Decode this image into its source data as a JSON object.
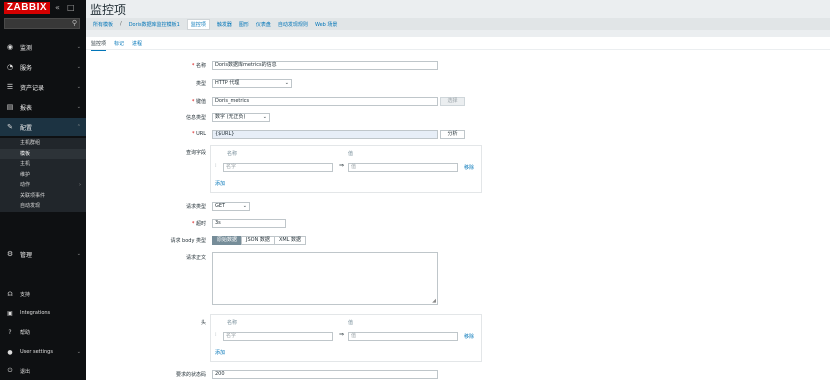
{
  "sidebar": {
    "logo": "ZABBIX",
    "collapse_icon": "«",
    "kiosk_icon": "□",
    "menu": [
      {
        "icon": "eye-icon",
        "glyph": "◉",
        "label": "监测"
      },
      {
        "icon": "clock-icon",
        "glyph": "◔",
        "label": "服务"
      },
      {
        "icon": "list-icon",
        "glyph": "☰",
        "label": "资产记录"
      },
      {
        "icon": "chart-icon",
        "glyph": "▤",
        "label": "报表"
      },
      {
        "icon": "wrench-icon",
        "glyph": "✎",
        "label": "配置"
      }
    ],
    "config_sub": [
      {
        "label": "主机群组"
      },
      {
        "label": "模板"
      },
      {
        "label": "主机"
      },
      {
        "label": "维护"
      },
      {
        "label": "动作"
      },
      {
        "label": "关联项事件"
      },
      {
        "label": "自动发现"
      }
    ],
    "admin": {
      "icon": "gear-icon",
      "glyph": "⚙",
      "label": "管理"
    },
    "footer": [
      {
        "icon": "support-icon",
        "glyph": "☊",
        "label": "支持"
      },
      {
        "icon": "integrations-icon",
        "glyph": "▣",
        "label": "Integrations"
      },
      {
        "icon": "help-icon",
        "glyph": "?",
        "label": "帮助"
      },
      {
        "icon": "user-icon",
        "glyph": "●",
        "label": "User settings"
      },
      {
        "icon": "power-icon",
        "glyph": "⏻",
        "label": "退出"
      }
    ]
  },
  "page": {
    "title": "监控项",
    "breadcrumbs": [
      "所有模板",
      "Doris数据库监控模板1",
      "监控项",
      "触发器",
      "图形",
      "仪表盘",
      "自动发现规则",
      "Web 场景"
    ],
    "breadcrumb_sep": "/",
    "tabs": [
      "监控项",
      "标记",
      "进程"
    ]
  },
  "form": {
    "name_label": "名称",
    "name_value": "Doris数据库metrics的信息",
    "type_label": "类型",
    "type_value": "HTTP 代理",
    "key_label": "键值",
    "key_value": "Doris_metrics",
    "select_btn": "选择",
    "info_type_label": "信息类型",
    "info_type_value": "数字 (无正负)",
    "url_label": "URL",
    "url_value": "{$URL}",
    "parse_btn": "分析",
    "query_label": "查询字段",
    "col_name": "名称",
    "col_value": "值",
    "name_placeholder": "名字",
    "value_placeholder": "值",
    "equals": "⇒",
    "remove": "移除",
    "add": "添加",
    "request_type_label": "请求类型",
    "request_type_value": "GET",
    "timeout_label": "超时",
    "timeout_value": "3s",
    "body_type_label": "请求 body 类型",
    "body_types": [
      "原始数据",
      "JSON 数据",
      "XML 数据"
    ],
    "body_label": "请求正文",
    "headers_label": "头",
    "status_label": "要求的状态码",
    "status_value": "200"
  }
}
